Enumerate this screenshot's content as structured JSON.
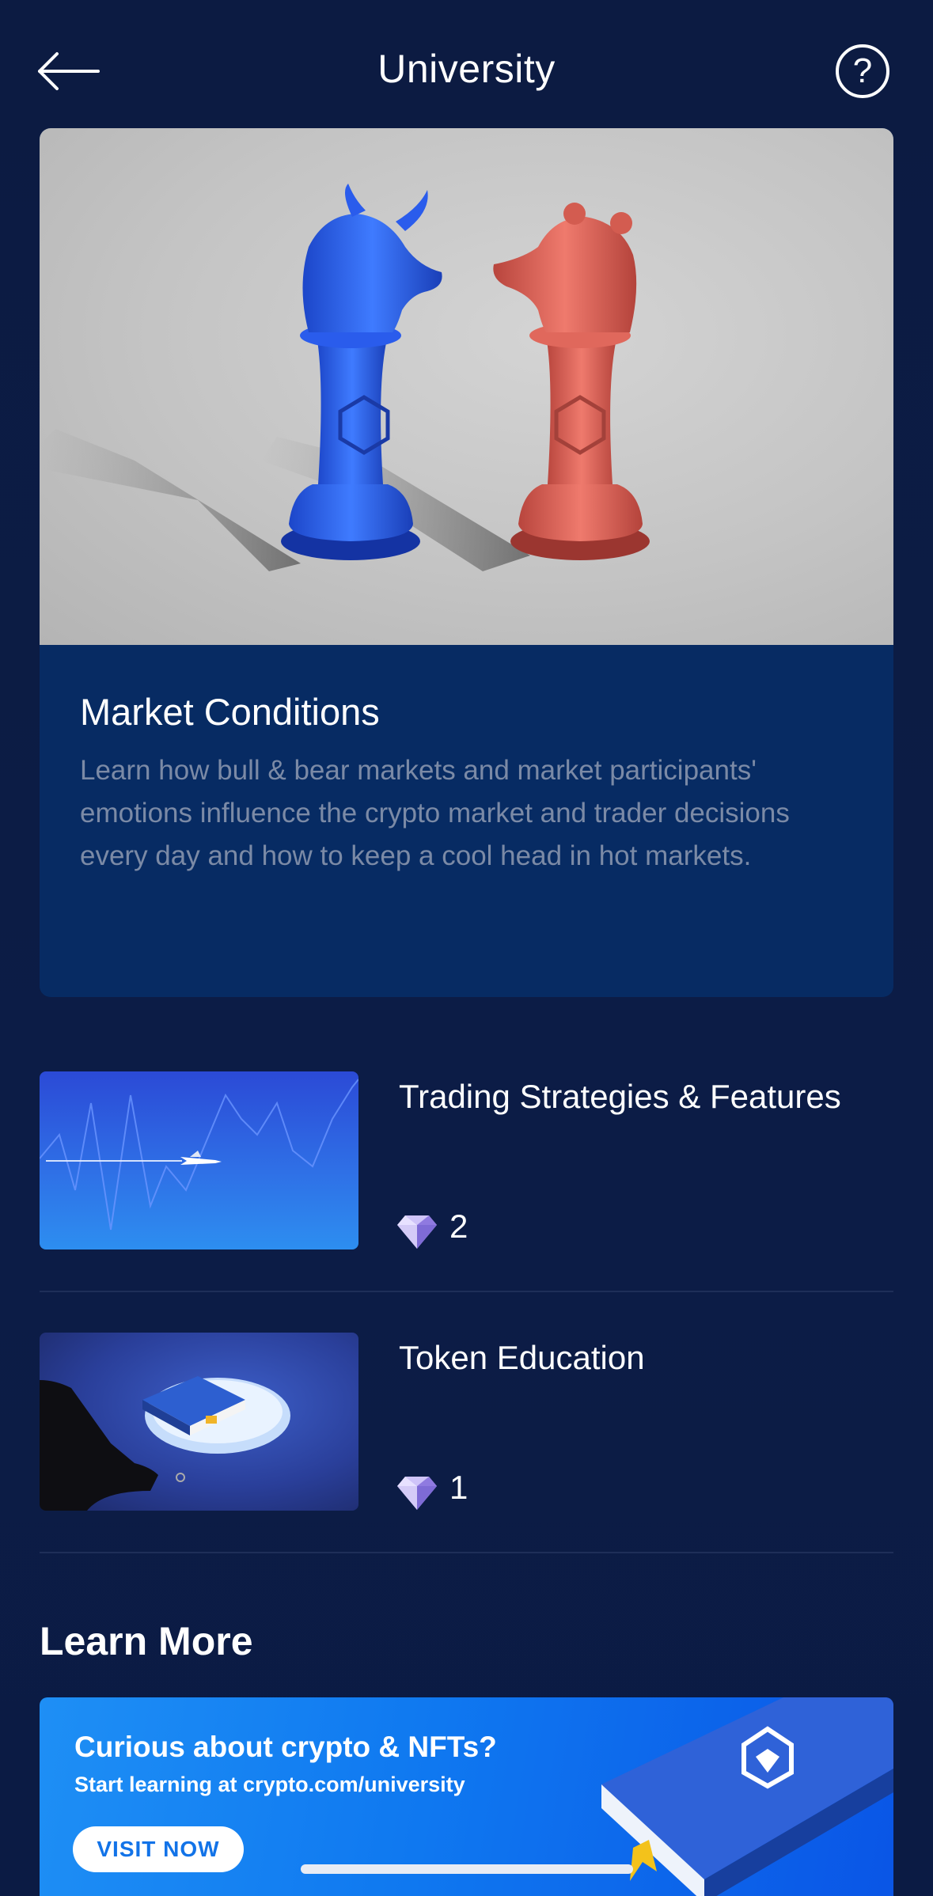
{
  "header": {
    "title": "University",
    "back_icon": "arrow-left-icon",
    "help_icon": "question-circle-icon",
    "help_glyph": "?"
  },
  "featured": {
    "title": "Market Conditions",
    "description": "Learn how bull & bear markets and market participants' emotions influence the crypto market and trader decisions every day and how to keep a cool head in hot markets."
  },
  "courses": [
    {
      "title": "Trading Strategies & Features",
      "count": "2",
      "icon": "diamond-icon"
    },
    {
      "title": "Token Education",
      "count": "1",
      "icon": "diamond-icon"
    }
  ],
  "learn_more": {
    "title": "Learn More",
    "banner": {
      "headline": "Curious about crypto & NFTs?",
      "subline": "Start learning at crypto.com/university",
      "button": "VISIT NOW"
    }
  },
  "colors": {
    "background": "#0c1b42",
    "card": "#072b63",
    "muted_text": "#7b8aa6",
    "bull": "#2156d9",
    "bear": "#d9574d"
  }
}
